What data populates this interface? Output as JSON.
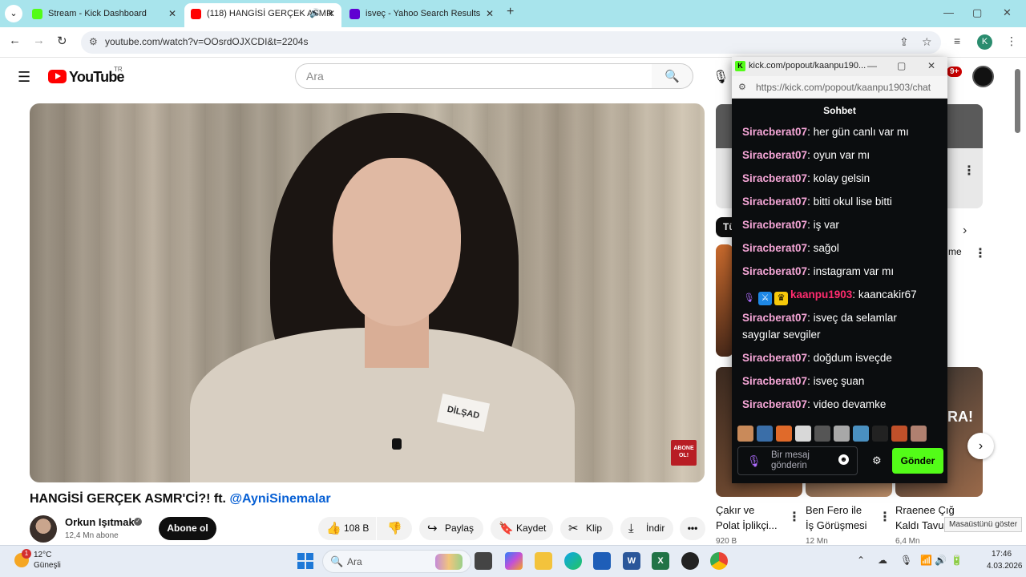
{
  "browser": {
    "tabs": [
      {
        "title": "Stream - Kick Dashboard",
        "favicon_color": "#53fc18"
      },
      {
        "title": "(118) HANGİSİ GERÇEK ASMR",
        "favicon_color": "#ff0000"
      },
      {
        "title": "isveç - Yahoo Search Results",
        "favicon_color": "#6001d2"
      }
    ],
    "new_tab_label": "+",
    "address": "youtube.com/watch?v=OOsrdOJXCDI&t=2204s",
    "profile_initial": "K"
  },
  "youtube": {
    "logo_text": "YouTube",
    "region": "TR",
    "search_placeholder": "Ara",
    "notification_count": "9+",
    "video": {
      "name_badge": "DİLŞAD",
      "overlay_badge": "ABONE OL!",
      "title": "HANGİSİ GERÇEK ASMR'Cİ?! ft.",
      "title_mention": "@AyniSinemalar",
      "channel": "Orkun Işıtmak",
      "subscribers": "12,4 Mn abone",
      "subscribe_label": "Abone ol",
      "likes": "108 B",
      "share_label": "Paylaş",
      "save_label": "Kaydet",
      "clip_label": "Klip",
      "download_label": "İndir"
    },
    "sidebar": {
      "chip_partial": "Tü",
      "partial_text": "me",
      "cards": [
        {
          "title_1": "Çakır ve",
          "title_2": "Polat İplikçi...",
          "meta": "920 B"
        },
        {
          "title_1": "Ben Fero ile",
          "title_2": "İş Görüşmesi",
          "meta": "12 Mn"
        },
        {
          "title_1": "Rraenee Çığ",
          "title_2": "Kaldı Tavu",
          "meta": "6,4 Mn"
        }
      ],
      "thumb_text": "RA!"
    },
    "desktop_tooltip": "Masaüstünü göster"
  },
  "kick_popup": {
    "window_title": "kick.com/popout/kaanpu190...",
    "url": "https://kick.com/popout/kaanpu1903/chat",
    "header": "Sohbet",
    "messages": [
      {
        "user": "Siracberat07",
        "text": "her gün canlı var mı"
      },
      {
        "user": "Siracberat07",
        "text": "oyun var mı"
      },
      {
        "user": "Siracberat07",
        "text": "kolay gelsin"
      },
      {
        "user": "Siracberat07",
        "text": "bitti okul lise bitti"
      },
      {
        "user": "Siracberat07",
        "text": "iş var"
      },
      {
        "user": "Siracberat07",
        "text": "sağol"
      },
      {
        "user": "Siracberat07",
        "text": "instagram var mı"
      },
      {
        "user": "kaanpu1903",
        "text": "kaancakir67"
      },
      {
        "user": "Siracberat07",
        "text": "isveç da selamlar saygılar sevgiler"
      },
      {
        "user": "Siracberat07",
        "text": "doğdum isveçde"
      },
      {
        "user": "Siracberat07",
        "text": "isveç şuan"
      },
      {
        "user": "Siracberat07",
        "text": "video devamke"
      }
    ],
    "input_placeholder": "Bir mesaj gönderin",
    "send_label": "Gönder",
    "colors": {
      "accent": "#53fc18",
      "username": "#f6a6d7",
      "streamer": "#ff2b6e"
    }
  },
  "taskbar": {
    "temperature": "12°C",
    "weather": "Güneşli",
    "weather_badge": "1",
    "search_label": "Ara",
    "time": "17:46",
    "date": "4.03.2026"
  }
}
